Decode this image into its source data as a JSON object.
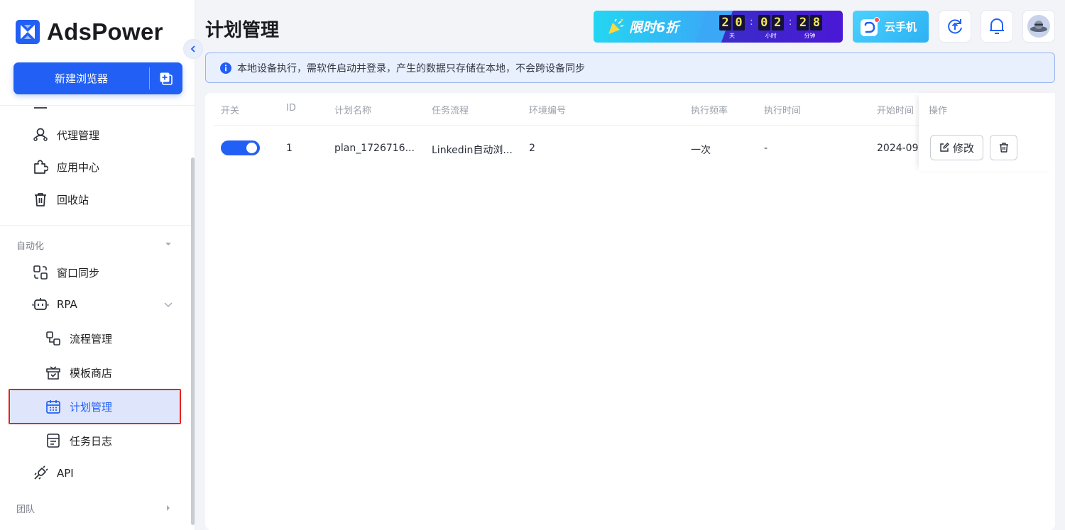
{
  "brand": {
    "name": "AdsPower"
  },
  "sidebar": {
    "new_browser_label": "新建浏览器",
    "items": [
      {
        "label": "代理管理",
        "icon": "proxy-icon"
      },
      {
        "label": "应用中心",
        "icon": "puzzle-icon"
      },
      {
        "label": "回收站",
        "icon": "trash-icon"
      }
    ],
    "automation_section": "自动化",
    "automation_items": [
      {
        "label": "窗口同步",
        "icon": "window-sync-icon"
      },
      {
        "label": "RPA",
        "icon": "robot-icon"
      }
    ],
    "rpa_children": [
      {
        "label": "流程管理",
        "icon": "flow-icon"
      },
      {
        "label": "模板商店",
        "icon": "store-icon"
      },
      {
        "label": "计划管理",
        "icon": "calendar-icon",
        "active": true
      },
      {
        "label": "任务日志",
        "icon": "log-icon"
      }
    ],
    "api_label": "API",
    "team_section": "团队"
  },
  "header": {
    "title": "计划管理",
    "promo": {
      "title": "限时6折",
      "countdown": [
        {
          "digits": [
            "2",
            "0"
          ],
          "unit": "天"
        },
        {
          "digits": [
            "0",
            "2"
          ],
          "unit": "小时"
        },
        {
          "digits": [
            "2",
            "8"
          ],
          "unit": "分钟"
        }
      ]
    },
    "cloud_phone_label": "云手机"
  },
  "notice": {
    "text": "本地设备执行，需软件启动并登录，产生的数据只存储在本地，不会跨设备同步"
  },
  "table": {
    "columns": {
      "switch": "开关",
      "id": "ID",
      "plan_name": "计划名称",
      "task_flow": "任务流程",
      "env_no": "环境编号",
      "frequency": "执行频率",
      "exec_time": "执行时间",
      "start_time": "开始时间",
      "actions": "操作"
    },
    "rows": [
      {
        "enabled": true,
        "id": "1",
        "plan_name": "plan_1726716...",
        "task_flow": "Linkedin自动浏...",
        "env_no": "2",
        "frequency": "一次",
        "exec_time": "-",
        "start_time": "2024-09-",
        "edit_label": "修改"
      }
    ]
  },
  "colors": {
    "accent": "#2260f5",
    "highlight_outline": "#e8231c"
  }
}
